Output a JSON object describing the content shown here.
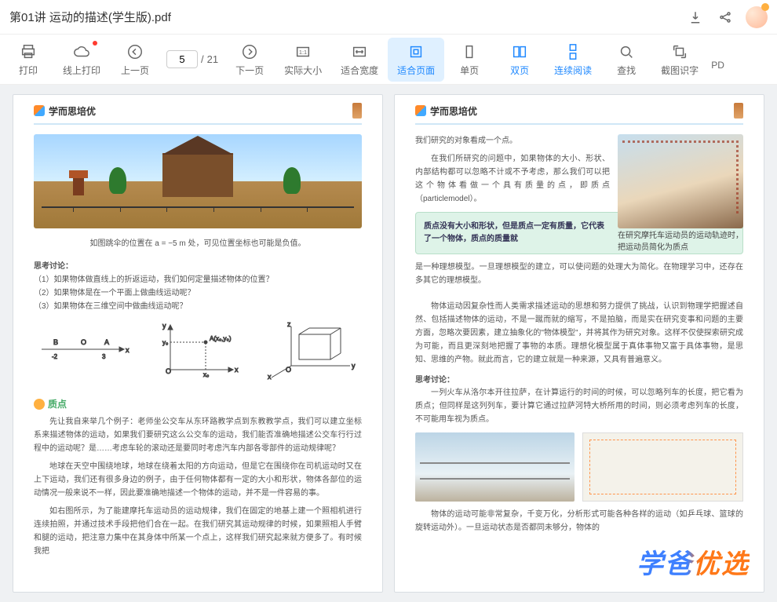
{
  "title": "第01讲 运动的描述(学生版).pdf",
  "page": {
    "current": "5",
    "total": "21",
    "sep": "/"
  },
  "toolbar": {
    "print": "打印",
    "onlinePrint": "线上打印",
    "prevPage": "上一页",
    "nextPage": "下一页",
    "actualSize": "实际大小",
    "fitWidth": "适合宽度",
    "fitPage": "适合页面",
    "single": "单页",
    "double": "双页",
    "continuous": "连续阅读",
    "find": "查找",
    "ocr": "截图识字",
    "pd": "PD"
  },
  "doc": {
    "brand": "学而思培优",
    "p1": {
      "caption": "如图跳伞的位置在 a = −5 m 处，可见位置坐标也可能是负值。",
      "think": "思考讨论：",
      "q1": "（1）如果物体做直线上的折返运动，我们如何定量描述物体的位置？",
      "q2": "（2）如果物体是在一个平面上做曲线运动呢？",
      "q3": "（3）如果物体在三维空间中做曲线运动呢？",
      "sect": "质点",
      "para1": "先让我自来举几个例子：老师坐公交车从东环路教学点到东教教学点，我们可以建立坐标系来描述物体的运动，如果我们要研究这么公交车的运动，我们能否准确地描述公交车行行过程中的运动呢？是……考虑车轮的滚动还是要同时考虑汽车内部各零部件的运动规律呢？",
      "para2": "地球在天空中围绕地球，地球在绕着太阳的方向运动，但是它在围绕你在司机运动时又在上下运动，我们还有很多身边的例子，由于任何物体都有一定的大小和形状，物体各部位的运动情况一般来说不一样，因此要准确地描述一个物体的运动，并不是一件容易的事。",
      "para3": "如右图所示，为了能建摩托车运动员的运动规律，我们在固定的地基上建一个照相机进行连续拍照，并通过技术手段把他们合在一起。在我们研究其运动规律的时候，如果照相人手臂和腿的运动，把注意力集中在其身体中所某一个点上，这样我们研究起来就方便多了。有时候我把",
      "axis": {
        "O": "O",
        "x": "x",
        "y": "y",
        "z": "z",
        "A": "A",
        "B": "B",
        "x0": "x₀",
        "y0": "y₀",
        "Ax": "A(x₀, y₀)"
      }
    },
    "p2": {
      "l1": "我们研究的对象看成一个点。",
      "l2": "在我们所研究的问题中，如果物体的大小、形状、内部结构都可以忽略不计或不予考虑，那么我们可以把这个物体看做一个具有质量的点，即质点（particlemodel）。",
      "box": "质点没有大小和形状，但是质点一定有质量，它代表了一个物体，质点的质量就",
      "boxTail": "是一种理想模型。一旦理想模型的建立，可以使问题的处理大为简化。在物理学习中，还存在多其它的理想模型。",
      "motoCap": "在研究摩托车运动员的运动轨迹时，把运动员简化为质点",
      "para4": "物体运动因复杂性而人类需求描述运动的思想和努力提供了挑战，认识到物理学把握述自然、包括描述物体的运动，不是一蹴而就的缩写，不是拍脑，而是实在研究变事和问题的主要方面，忽略次要因素，建立抽象化的\"物体模型\"，并将其作为研究对象。这样不仅使探索研究成为可能，而且更深刻地把握了事物的本质。理想化模型属于真体事物又富于具体事物，是思知、思维的产物。就此而言，它的建立就是一种来源，又具有普遍意义。",
      "think2": "思考讨论：",
      "para5": "一列火车从洛尔本开往拉萨，在计算运行的时间的时候，可以忽略列车的长度，把它看为质点；但同样是这列列车，要计算它通过拉萨河特大桥所用的时间，则必须考虑列车的长度，不可能用车视为质点。",
      "para6": "物体的运动可能非常复杂，千变万化，分析形式可能各种各样的运动（如乒乓球、篮球的旋转运动外）。一旦运动状态是否都同未够分，物体的",
      "watermark": "学爸优选"
    }
  }
}
